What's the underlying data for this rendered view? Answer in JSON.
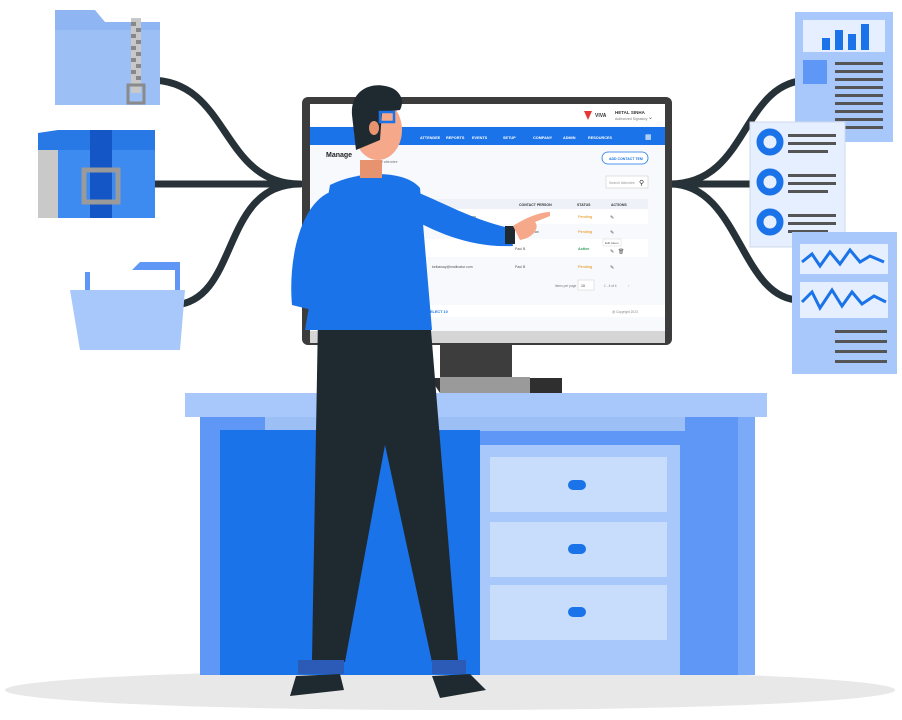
{
  "app": {
    "brand_name": "VIVA",
    "user_name": "HETAL SINHA",
    "user_role": "Authorized Signatory"
  },
  "nav": {
    "items": [
      "ATTENDEE",
      "REPORTS",
      "EVENTS",
      "SETUP",
      "COMPANY",
      "ADMIN",
      "RESOURCES"
    ]
  },
  "page": {
    "title": "Manage",
    "subtitle_fragment": "of attendee",
    "add_button": "ADD CONTACT TEM",
    "search_placeholder": "Search Attendee"
  },
  "table": {
    "headers": [
      "CONTACT PERSON",
      "STATUS",
      "ACTIONS"
    ],
    "rows": [
      {
        "email": "@mailinator.com",
        "contact": "",
        "status": "Pending"
      },
      {
        "email": "",
        "contact": "ravan",
        "status": "Pending"
      },
      {
        "email": "",
        "contact": "Paul B",
        "status": "Active"
      },
      {
        "email": "keibaway@mailinator.com",
        "contact": "Paul B",
        "status": "Pending"
      }
    ],
    "tooltip": "Edit Ateen",
    "rows_per_page_label": "Items per page",
    "rows_per_page_value": "10",
    "range_label": "1 - 4 of 4"
  },
  "footer": {
    "left": "ELECT 10",
    "right": "@ Copyright 2023"
  },
  "colors": {
    "primary": "#1a73e8",
    "light_blue": "#a8c7fa",
    "mid_blue": "#5e97f6",
    "dark": "#1f2a30",
    "active_green": "#2e9d57",
    "pending_orange": "#e68a00"
  },
  "icons": [
    "zip-folder-icon",
    "archive-box-icon",
    "open-folder-icon",
    "bar-chart-document-icon",
    "donut-list-document-icon",
    "wave-chart-document-icon"
  ]
}
